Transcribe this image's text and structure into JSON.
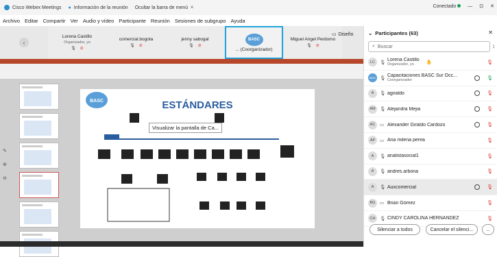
{
  "titlebar": {
    "app_name": "Cisco Webex Meetings",
    "meeting_info": "Información de la reunión",
    "hide_menu": "Ocultar la barra de menú",
    "status": "Conectado",
    "win_min": "—",
    "win_restore": "⊡",
    "win_close": "✕"
  },
  "menu": [
    "Archivo",
    "Editar",
    "Compartir",
    "Ver",
    "Audio y vídeo",
    "Participante",
    "Reunión",
    "Sesiones de subgrupo",
    "Ayuda"
  ],
  "video_tiles": [
    {
      "name": "Lorena Castillo",
      "role": "Organizador, yo"
    },
    {
      "name": "comercial.bogota",
      "role": ""
    },
    {
      "name": "jenny sabogal",
      "role": ""
    },
    {
      "name": "... (Coorganizador)",
      "role": ""
    },
    {
      "name": "Miguel Angel Perdomo",
      "role": ""
    }
  ],
  "logo_text": "BASC",
  "diseno_label": "Diseño",
  "share_tooltip": "Visualizar la pantalla de Ca...",
  "slide_title": "ESTÁNDARES",
  "slide_logo": "BASC",
  "participants": {
    "title": "Participantes (63)",
    "search_placeholder": "Buscar",
    "items": [
      {
        "initials": "LC",
        "name": "Lorena Castillo",
        "sub": "Organizador, yo"
      },
      {
        "initials": "BASC",
        "name": "Capacitaciones BASC Sur Occ...",
        "sub": "Coorganizador"
      },
      {
        "initials": "A",
        "name": "agiraldo",
        "sub": ""
      },
      {
        "initials": "AM",
        "name": "Alejandra Mejia",
        "sub": ""
      },
      {
        "initials": "AC",
        "name": "Alexander Giraldo Cardozo",
        "sub": ""
      },
      {
        "initials": "AP",
        "name": "Ana milena perea",
        "sub": ""
      },
      {
        "initials": "A",
        "name": "analistasocial1",
        "sub": ""
      },
      {
        "initials": "A",
        "name": "andres.arbona",
        "sub": ""
      },
      {
        "initials": "A",
        "name": "Auxcomercial",
        "sub": ""
      },
      {
        "initials": "BG",
        "name": "Brian Gómez",
        "sub": ""
      },
      {
        "initials": "CH",
        "name": "CINDY CAROLINA HERNANDEZ",
        "sub": ""
      }
    ],
    "mute_all": "Silenciar a todos",
    "cancel_mute": "Cancelar el silenci...",
    "more": "..."
  }
}
